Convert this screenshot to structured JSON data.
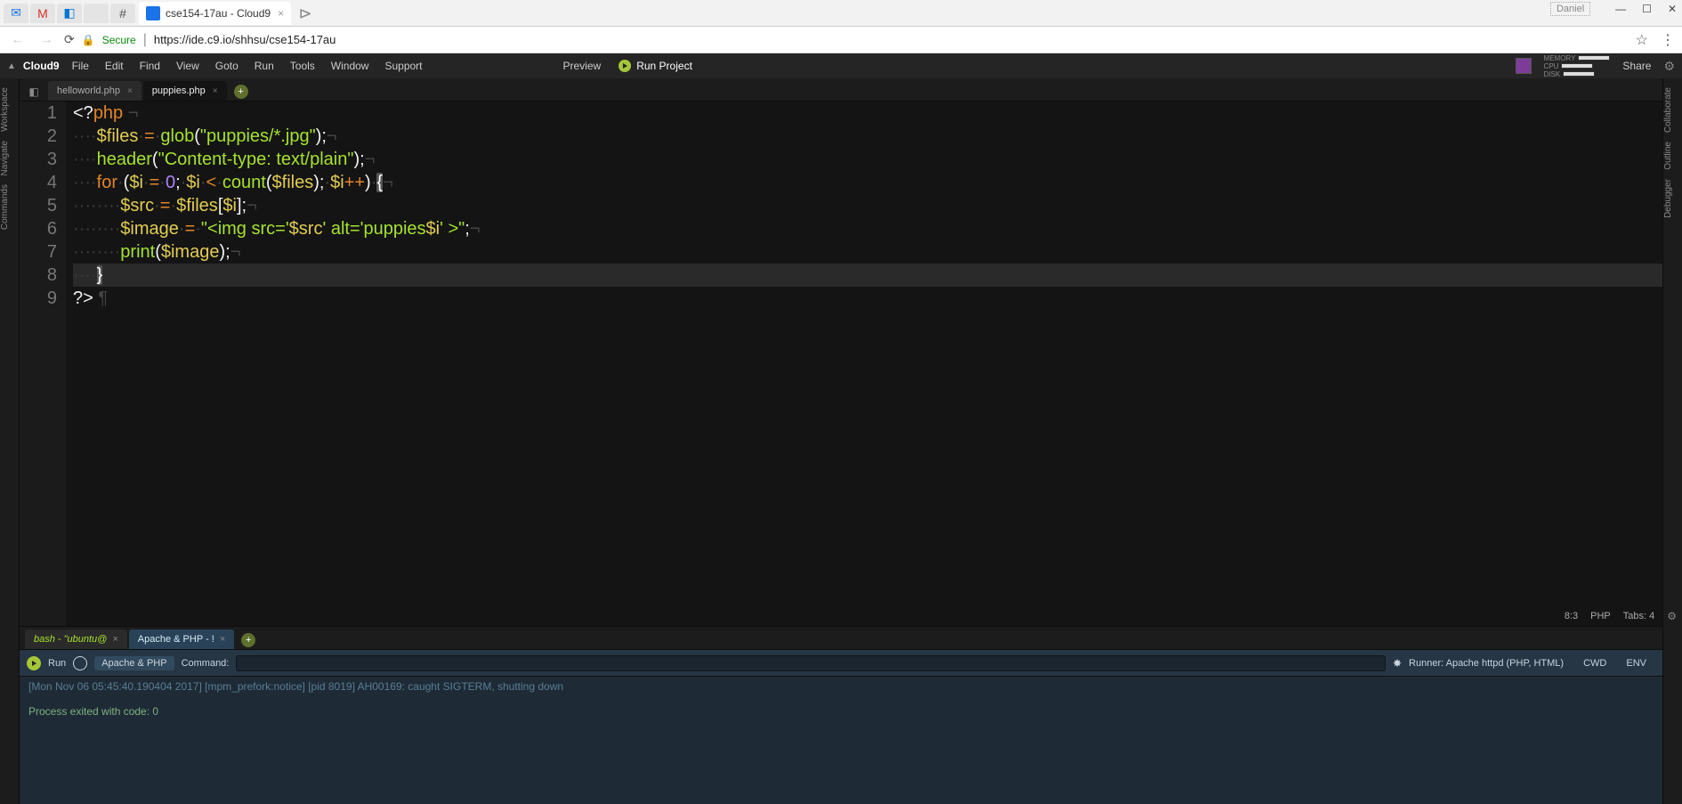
{
  "browser": {
    "tab_title": "cse154-17au - Cloud9",
    "user_label": "Daniel",
    "secure_label": "Secure",
    "url": "https://ide.c9.io/shhsu/cse154-17au"
  },
  "menubar": {
    "brand": "Cloud9",
    "items": [
      "File",
      "Edit",
      "Find",
      "View",
      "Goto",
      "Run",
      "Tools",
      "Window",
      "Support"
    ],
    "preview": "Preview",
    "run_project": "Run Project",
    "share": "Share",
    "meters": {
      "memory": "MEMORY",
      "cpu": "CPU",
      "disk": "DISK"
    }
  },
  "left_rail": [
    "Workspace",
    "Navigate",
    "Commands"
  ],
  "right_rail": [
    "Collaborate",
    "Outline",
    "Debugger"
  ],
  "file_tabs": {
    "tabs": [
      {
        "name": "helloworld.php",
        "active": false
      },
      {
        "name": "puppies.php",
        "active": true
      }
    ]
  },
  "code": {
    "line1": {
      "open": "<?",
      "kw": "php"
    },
    "line2": {
      "var": "$files",
      "op1": "=",
      "fn": "glob",
      "str": "\"puppies/*.jpg\""
    },
    "line3": {
      "fn": "header",
      "str": "\"Content-type: text/plain\""
    },
    "line4": {
      "kw": "for",
      "v1": "$i",
      "eq": "=",
      "n0": "0",
      "v2": "$i",
      "lt": "<",
      "fn": "count",
      "v3": "$files",
      "v4": "$i",
      "inc": "++"
    },
    "line5": {
      "v1": "$src",
      "eq": "=",
      "v2": "$files",
      "v3": "$i"
    },
    "line6": {
      "v1": "$image",
      "eq": "=",
      "s1": "\"<img src='",
      "v2": "$src",
      "s2": "' alt='puppies",
      "v3": "$i",
      "s3": "' >\""
    },
    "line7": {
      "fn": "print",
      "v1": "$image"
    },
    "line9": {
      "close": "?>"
    }
  },
  "status": {
    "pos": "8:3",
    "lang": "PHP",
    "tabs": "Tabs: 4"
  },
  "bottom": {
    "tab1": "bash - \"ubuntu@",
    "tab2": "Apache & PHP - !",
    "run": "Run",
    "runner_chip": "Apache & PHP",
    "command_label": "Command:",
    "runner_info": "Runner: Apache httpd (PHP, HTML)",
    "cwd": "CWD",
    "env": "ENV",
    "term_line1": "[Mon Nov 06 05:45:40.190404 2017] [mpm_prefork:notice] [pid 8019] AH00169: caught SIGTERM, shutting down",
    "term_line3": "Process exited with code: 0"
  }
}
